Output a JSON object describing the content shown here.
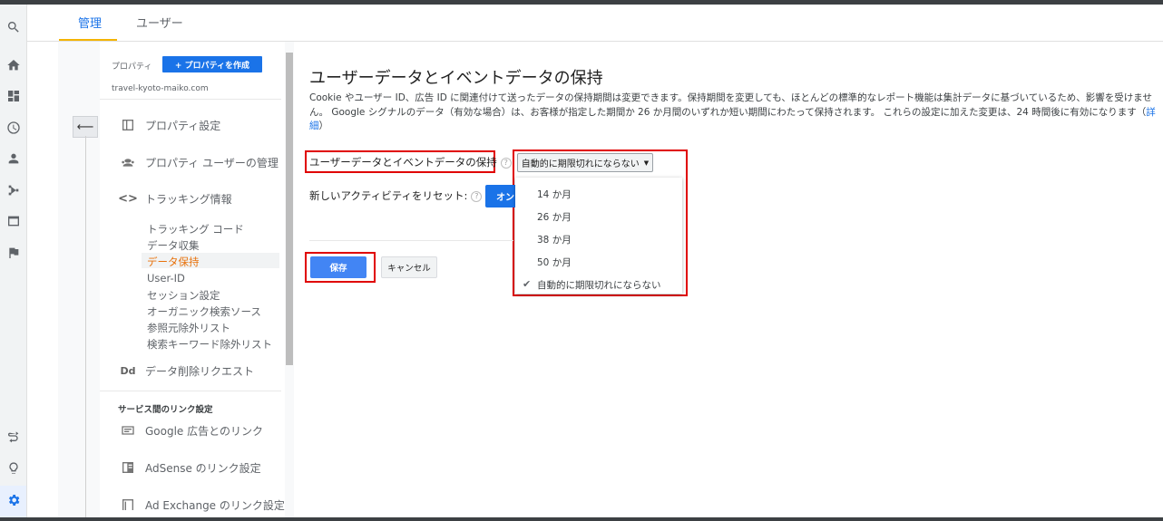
{
  "tabs": [
    {
      "label": "管理"
    },
    {
      "label": "ユーザー"
    }
  ],
  "nav": {
    "property_label": "プロパティ",
    "create_property": "+ プロパティを作成",
    "site": "travel-kyoto-maiko.com",
    "items": [
      {
        "label": "プロパティ設定"
      },
      {
        "label": "プロパティ ユーザーの管理"
      },
      {
        "label": "トラッキング情報"
      }
    ],
    "tracking_sub": [
      {
        "label": "トラッキング コード"
      },
      {
        "label": "データ収集"
      },
      {
        "label": "データ保持"
      },
      {
        "label": "User-ID"
      },
      {
        "label": "セッション設定"
      },
      {
        "label": "オーガニック検索ソース"
      },
      {
        "label": "参照元除外リスト"
      },
      {
        "label": "検索キーワード除外リスト"
      }
    ],
    "data_deletion": "データ削除リクエスト",
    "data_deletion_icon": "Dd",
    "service_links_header": "サービス間のリンク設定",
    "link_items": [
      {
        "label": "Google 広告とのリンク"
      },
      {
        "label": "AdSense のリンク設定"
      },
      {
        "label": "Ad Exchange のリンク設定"
      }
    ]
  },
  "main": {
    "title": "ユーザーデータとイベントデータの保持",
    "description": "Cookie やユーザー ID、広告 ID に関連付けて送ったデータの保持期間は変更できます。保持期間を変更しても、ほとんどの標準的なレポート機能は集計データに基づいているため、影響を受けません。 Google シグナルのデータ（有効な場合）は、お客様が指定した期間か 26 か月間のいずれか短い期間にわたって保持されます。 これらの設定に加えた変更は、24 時間後に有効になります",
    "details_link": "詳細",
    "retention_label": "ユーザーデータとイベントデータの保持",
    "retention_value": "自動的に期限切れにならない",
    "reset_label": "新しいアクティビティをリセット:",
    "toggle_label": "オン",
    "options": [
      {
        "label": "14 か月"
      },
      {
        "label": "26 か月"
      },
      {
        "label": "38 か月"
      },
      {
        "label": "50 か月"
      },
      {
        "label": "自動的に期限切れにならない"
      }
    ],
    "save": "保存",
    "cancel": "キャンセル"
  },
  "colors": {
    "accent": "#1a73e8",
    "highlight": "#e00000",
    "active_nav": "#e8710a"
  }
}
